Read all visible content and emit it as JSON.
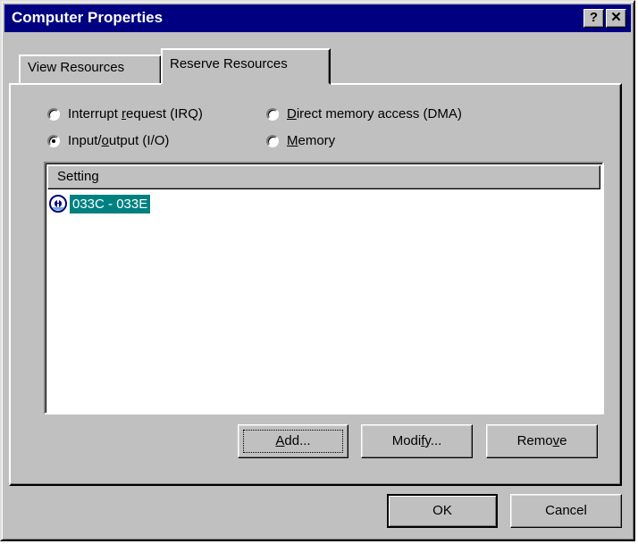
{
  "window": {
    "title": "Computer Properties",
    "help_label": "?",
    "close_label": "✕"
  },
  "tabs": [
    {
      "label": "View Resources",
      "active": false
    },
    {
      "label": "Reserve Resources",
      "active": true
    }
  ],
  "radios": {
    "irq": {
      "pre": "Interrupt ",
      "key": "r",
      "post": "equest (IRQ)",
      "selected": false
    },
    "dma": {
      "pre": "",
      "key": "D",
      "post": "irect memory access (DMA)",
      "selected": false
    },
    "io": {
      "pre": "Input/",
      "key": "o",
      "post": "utput (I/O)",
      "selected": true
    },
    "memory": {
      "pre": "",
      "key": "M",
      "post": "emory",
      "selected": false
    }
  },
  "list": {
    "column_header": "Setting",
    "items": [
      {
        "text": "033C - 033E",
        "icon": "io-port-icon",
        "selected": true
      }
    ]
  },
  "buttons": {
    "add": {
      "key": "A",
      "rest": "dd..."
    },
    "modify": {
      "pre": "Modi",
      "key": "f",
      "post": "y..."
    },
    "remove": {
      "pre": "Remo",
      "key": "v",
      "post": "e"
    },
    "ok": "OK",
    "cancel": "Cancel"
  },
  "colors": {
    "titlebar": "#000080",
    "face": "#c0c0c0",
    "selection": "#008080"
  }
}
